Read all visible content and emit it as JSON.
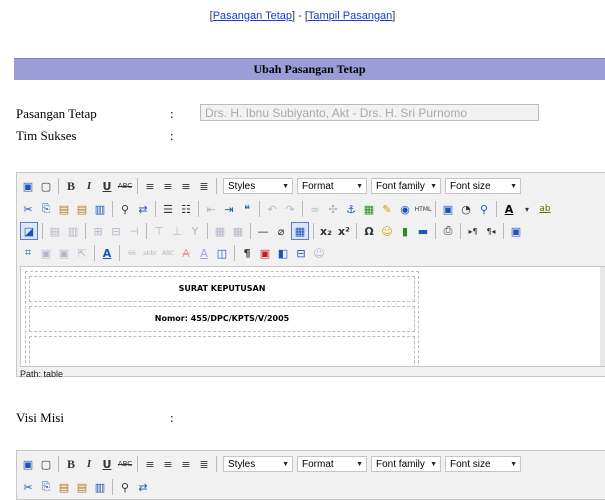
{
  "top_links": {
    "link1": "Pasangan Tetap",
    "sep": "] - [",
    "link2": "Tampil Pasangan"
  },
  "title": "Ubah Pasangan Tetap",
  "form": {
    "pasangan_label": "Pasangan Tetap",
    "pasangan_value": "Drs. H. Ibnu Subiyanto, Akt - Drs. H. Sri Purnomo",
    "tim_label": "Tim Sukses",
    "visi_label": "Visi Misi",
    "colon": ":"
  },
  "editor": {
    "styles": "Styles",
    "format": "Format",
    "font_family": "Font family",
    "font_size": "Font size",
    "content_line1": "SURAT KEPUTUSAN",
    "content_line2": "Nomor: 455/DPC/KPTS/V/2005",
    "path": "Path: table"
  },
  "icons": {
    "row1": [
      "save-icon",
      "new-document-icon",
      "bold-icon",
      "italic-icon",
      "underline-icon",
      "strikethrough-icon",
      "align-left-icon",
      "align-center-icon",
      "align-right-icon",
      "align-justify-icon"
    ],
    "row2": [
      "cut-icon",
      "copy-icon",
      "paste-icon",
      "paste-text-icon",
      "paste-word-icon",
      "find-icon",
      "replace-icon",
      "bullet-list-icon",
      "numbered-list-icon",
      "outdent-icon",
      "indent-icon",
      "blockquote-icon",
      "undo-icon",
      "redo-icon",
      "link-icon",
      "unlink-icon",
      "anchor-icon",
      "image-icon",
      "cleanup-icon",
      "help-icon",
      "html-icon",
      "media-icon",
      "print-icon",
      "preview-icon",
      "text-color-icon",
      "highlight-icon"
    ],
    "row3": [
      "visual-aid-icon",
      "table-icon",
      "row-props-icon",
      "cell-props-icon",
      "insert-row-icon",
      "delete-row-icon",
      "split-cell-icon",
      "merge-cell-icon",
      "hr-icon",
      "remove-format-icon",
      "visual-table-icon",
      "subscript-icon",
      "superscript-icon",
      "charmap-icon",
      "emoticon-icon",
      "media-insert-icon",
      "advhr-icon",
      "print-icon-2",
      "ltr-icon",
      "rtl-icon",
      "fullscreen-icon"
    ],
    "row4": [
      "layer-insert-icon",
      "layer-forward-icon",
      "layer-backward-icon",
      "absolute-icon",
      "style-props-icon",
      "cite-icon",
      "abbr-icon",
      "acronym-icon",
      "del-icon",
      "ins-icon",
      "attribs-icon",
      "visual-chars-icon",
      "nonbreaking-icon",
      "template-icon",
      "pagebreak-icon",
      "spellcheck-icon"
    ]
  },
  "colors": {
    "title_bar": "#9c9cd6",
    "link": "#1a3ad0",
    "editor_bg": "#f1f1f1"
  }
}
